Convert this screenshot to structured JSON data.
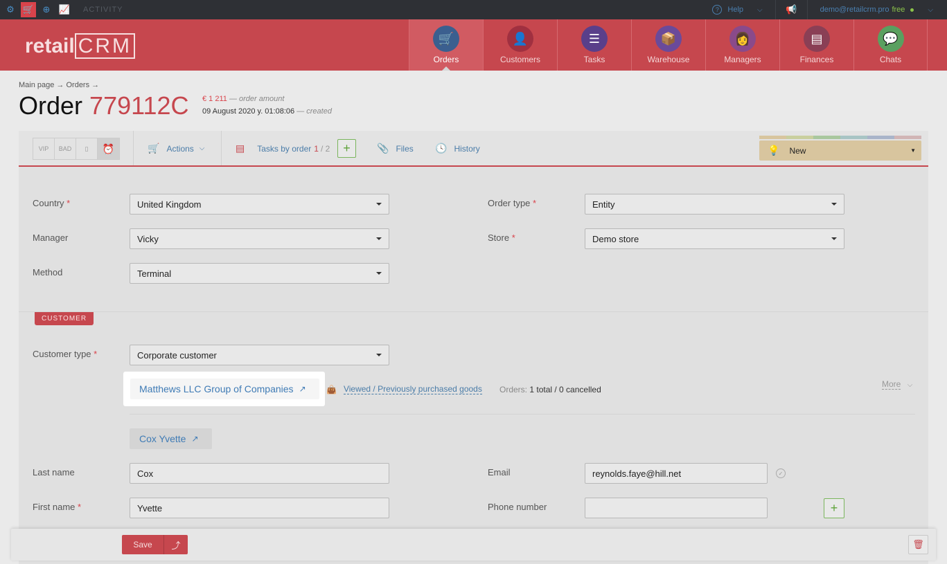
{
  "topbar": {
    "activity_label": "ACTIVITY",
    "help_label": "Help",
    "user_email": "demo@retailcrm.pro",
    "plan": "free"
  },
  "logo": {
    "text_a": "retail",
    "text_b": "CRM"
  },
  "nav": [
    {
      "label": "Orders",
      "icon": "cart-icon",
      "color": "#3b5f8f"
    },
    {
      "label": "Customers",
      "icon": "customer-icon",
      "color": "#a03040"
    },
    {
      "label": "Tasks",
      "icon": "tasks-icon",
      "color": "#5a3f8a"
    },
    {
      "label": "Warehouse",
      "icon": "warehouse-icon",
      "color": "#6a4a9a"
    },
    {
      "label": "Managers",
      "icon": "manager-icon",
      "color": "#8a4a8a"
    },
    {
      "label": "Finances",
      "icon": "finances-icon",
      "color": "#8a3f55"
    },
    {
      "label": "Chats",
      "icon": "chats-icon",
      "color": "#5aa060"
    }
  ],
  "breadcrumb": {
    "text": "Main page → Orders →"
  },
  "order": {
    "title_prefix": "Order",
    "number": "779112C",
    "amount": "€ 1 211",
    "amount_label": "— order amount",
    "created": "09 August 2020 y. 01:08:06",
    "created_label": "— created"
  },
  "toolbar": {
    "tag_vip": "VIP",
    "tag_bad": "BAD",
    "actions": "Actions",
    "tasks_by_order": "Tasks by order",
    "tasks_done": "1",
    "tasks_total": "/ 2",
    "files": "Files",
    "history": "History",
    "status": "New"
  },
  "form": {
    "country_label": "Country",
    "country_value": "United Kingdom",
    "order_type_label": "Order type",
    "order_type_value": "Entity",
    "manager_label": "Manager",
    "manager_value": "Vicky",
    "store_label": "Store",
    "store_value": "Demo store",
    "method_label": "Method",
    "method_value": "Terminal"
  },
  "customer": {
    "section_label": "CUSTOMER",
    "type_label": "Customer type",
    "type_value": "Corporate customer",
    "company_link": "Matthews LLC Group of Companies",
    "viewed_link": "Viewed / Previously purchased goods",
    "orders_label": "Orders:",
    "orders_value": "1 total / 0 cancelled",
    "more": "More",
    "contact_link": "Cox Yvette",
    "last_name_label": "Last name",
    "last_name_value": "Cox",
    "email_label": "Email",
    "email_value": "reynolds.faye@hill.net",
    "first_name_label": "First name",
    "first_name_value": "Yvette",
    "phone_label": "Phone number",
    "phone_value": ""
  },
  "bottom": {
    "save": "Save"
  }
}
